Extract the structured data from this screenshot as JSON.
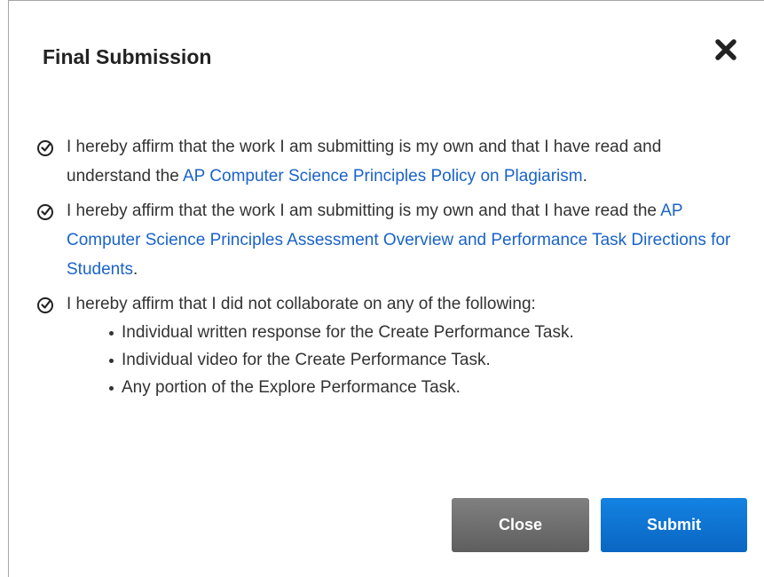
{
  "dialog": {
    "title": "Final Submission",
    "close_icon": "close-x-icon"
  },
  "affirmations": [
    {
      "checked": true,
      "text_before": " I hereby affirm that the work I am submitting is my own and that I have read and understand the ",
      "link": "AP Computer Science Principles Policy on Plagiarism",
      "text_after": "."
    },
    {
      "checked": true,
      "text_before": " I hereby affirm that the work I am submitting is my own and that I have read the ",
      "link": "AP Computer Science Principles Assessment Overview and Performance Task Directions for Students",
      "text_after": "."
    },
    {
      "checked": true,
      "text_before": " I hereby affirm that I did not collaborate on any of the following:",
      "bullets": [
        "Individual written response for the Create Performance Task.",
        "Individual video for the Create Performance Task.",
        "Any portion of the Explore Performance Task."
      ]
    }
  ],
  "buttons": {
    "close_label": "Close",
    "submit_label": "Submit"
  },
  "colors": {
    "link": "#1a63c9",
    "close_button": "#6e6e6e",
    "submit_button": "#0f74d6"
  }
}
